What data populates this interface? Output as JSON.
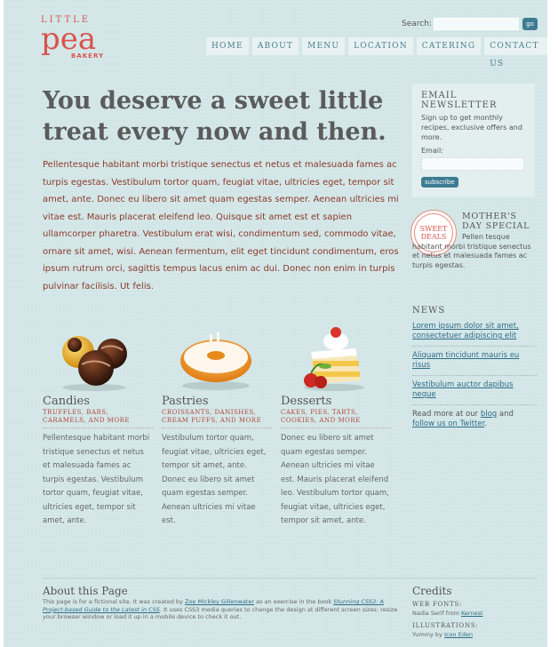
{
  "logo": {
    "top": "LITTLE",
    "main": "pea",
    "bottom": "BAKERY"
  },
  "search": {
    "label": "Search:",
    "value": "",
    "button": "go"
  },
  "nav": [
    "HOME",
    "ABOUT",
    "MENU",
    "LOCATION",
    "CATERING",
    "CONTACT US"
  ],
  "hero": {
    "title": "You deserve a sweet little treat every now and then.",
    "intro": "Pellentesque habitant morbi tristique senectus et netus et malesuada fames ac turpis egestas. Vestibulum tortor quam, feugiat vitae, ultricies eget, tempor sit amet, ante. Donec eu libero sit amet quam egestas semper. Aenean ultricies mi vitae est. Mauris placerat eleifend leo. Quisque sit amet est et sapien ullamcorper pharetra. Vestibulum erat wisi, condimentum sed, commodo vitae, ornare sit amet, wisi. Aenean fermentum, elit eget tincidunt condimentum, eros ipsum rutrum orci, sagittis tempus lacus enim ac dui. Donec non enim in turpis pulvinar facilisis. Ut felis."
  },
  "newsletter": {
    "title": "EMAIL NEWSLETTER",
    "desc": "Sign up to get monthly recipes, exclusive offers and more.",
    "email_label": "Email:",
    "email_value": "",
    "button": "subscribe"
  },
  "special": {
    "badge": [
      "SWEET",
      "DEALS"
    ],
    "title": "MOTHER'S DAY SPECIAL",
    "text": "Pellen tesque habitant morbi tristique senectus et netus et malesuada fames ac turpis egestas."
  },
  "news": {
    "title": "NEWS",
    "items": [
      "Lorem ipsum dolor sit amet, consectetuer adipiscing elit",
      "Aliquam tincidunt mauris eu risus",
      "Vestibulum auctor dapibus neque"
    ],
    "more_prefix": "Read more at our ",
    "blog_link": "blog",
    "more_middle": " and ",
    "twitter_link": "follow us on Twitter",
    "more_suffix": "."
  },
  "products": [
    {
      "name": "Candies",
      "sub": "TRUFFLES, BARS, CARAMELS, AND MORE",
      "text": "Pellentesque habitant morbi tristique senectus et netus et malesuada fames ac turpis egestas. Vestibulum tortor quam, feugiat vitae, ultricies eget, tempor sit amet, ante."
    },
    {
      "name": "Pastries",
      "sub": "CROISSANTS, DANISHES, CREAM PUFFS, AND MORE",
      "text": "Vestibulum tortor quam, feugiat vitae, ultricies eget, tempor sit amet, ante. Donec eu libero sit amet quam egestas semper. Aenean ultricies mi vitae est."
    },
    {
      "name": "Desserts",
      "sub": "CAKES, PIES, TARTS, COOKIES, AND MORE",
      "text": "Donec eu libero sit amet quam egestas semper. Aenean ultricies mi vitae est. Mauris placerat eleifend leo. Vestibulum tortor quam, feugiat vitae, ultricies eget, tempor sit amet, ante."
    }
  ],
  "about": {
    "title": "About this Page",
    "t1": "This page is for a fictional site. It was created by ",
    "author_link": "Zoe Mickley Gillenwater",
    "t2": " as an exercise in the book ",
    "book_link": "Stunning CSS3: A Project-based Guide to the Latest in CSS",
    "t3": ". It uses CSS3 media queries to change the design at different screen sizes: resize your browser window or load it up in a mobile device to check it out."
  },
  "credits": {
    "title": "Credits",
    "web_fonts_h": "WEB FONTS:",
    "web_fonts_t": "Nadia Serif from ",
    "web_fonts_link": "Kernest",
    "illus_h": "ILLUSTRATIONS:",
    "illus_t": "Yummy by ",
    "illus_link": "Icon Eden"
  },
  "colors": {
    "accent": "#d9534c",
    "link": "#2e6d8a",
    "button": "#3f7c93",
    "background": "#d3e6e7"
  }
}
